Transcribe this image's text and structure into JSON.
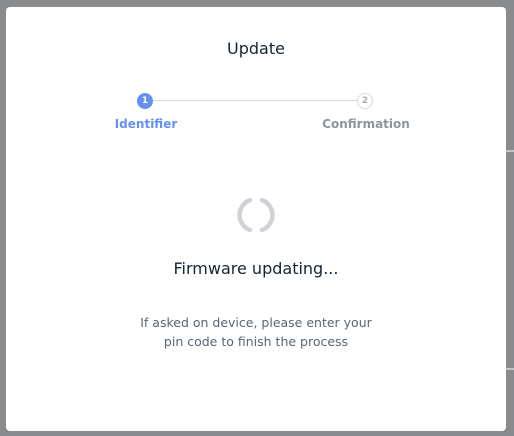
{
  "modal": {
    "title": "Update"
  },
  "stepper": {
    "steps": [
      {
        "number": "1",
        "label": "Identifier",
        "state": "active"
      },
      {
        "number": "2",
        "label": "Confirmation",
        "state": "pending"
      }
    ],
    "active_color": "#6490f1",
    "inactive_color": "#d6d9dd"
  },
  "content": {
    "spinner_icon": "loading-spinner-icon",
    "status": "Firmware updating...",
    "description_line1": "If asked on device, please enter your",
    "description_line2": "pin code to finish the process"
  }
}
